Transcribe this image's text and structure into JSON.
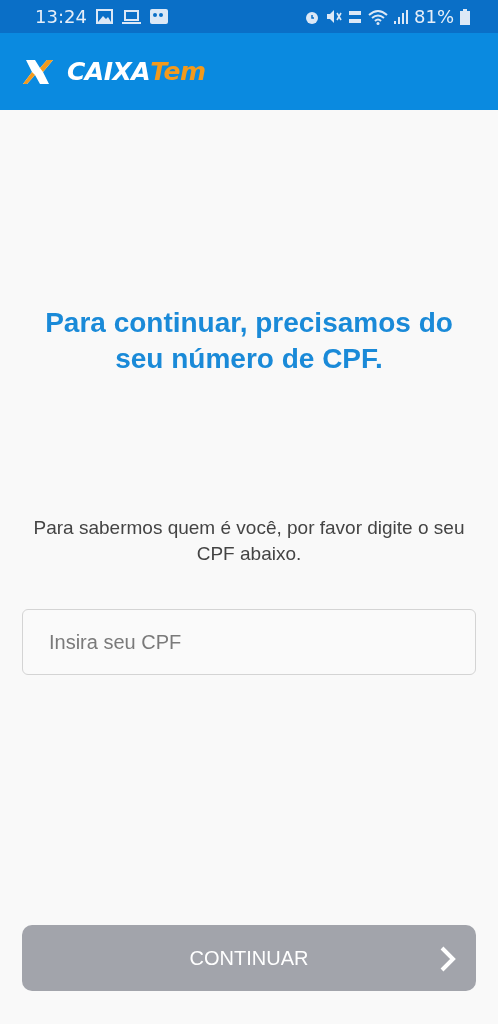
{
  "status_bar": {
    "time": "13:24",
    "battery_percent": "81%"
  },
  "app_bar": {
    "logo": {
      "word_1": "CAIXA",
      "word_2": "Tem"
    }
  },
  "heading": "Para continuar, precisamos do seu número de CPF.",
  "instructions": "Para sabermos quem é você, por favor digite o seu CPF abaixo.",
  "cpf_field": {
    "placeholder": "Insira seu CPF"
  },
  "continue_button": {
    "label": "CONTINUAR",
    "disabled": true
  }
}
